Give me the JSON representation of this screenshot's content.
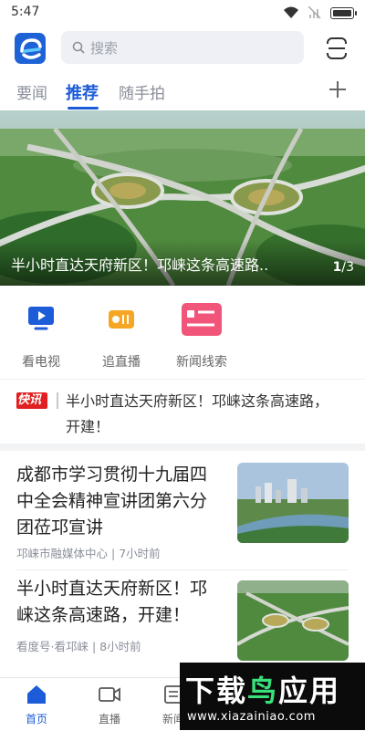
{
  "status_bar": {
    "time": "5:47"
  },
  "header": {
    "search_placeholder": "搜索"
  },
  "tabs": [
    {
      "label": "要闻",
      "active": false
    },
    {
      "label": "推荐",
      "active": true
    },
    {
      "label": "随手拍",
      "active": false
    }
  ],
  "banner": {
    "title": "半小时直达天府新区！邛崃这条高速路..",
    "index": "1",
    "total": "/3"
  },
  "quick_links": [
    {
      "label": "看电视",
      "icon": "tv-icon"
    },
    {
      "label": "追直播",
      "icon": "live-radio-icon"
    },
    {
      "label": "新闻线索",
      "icon": "news-tip-icon"
    }
  ],
  "flash": {
    "badge": "快讯",
    "text_line1": "半小时直达天府新区！邛崃这条高速路，",
    "text_line2": "开建！"
  },
  "news": [
    {
      "title": "成都市学习贯彻十九届四中全会精神宣讲团第六分团莅邛宣讲",
      "source": "邛崃市融媒体中心",
      "time": "7小时前",
      "thumb": "city-river-photo"
    },
    {
      "title": "半小时直达天府新区！邛崃这条高速路，开建！",
      "source": "看度号·看邛崃",
      "time": "8小时前",
      "thumb": "highway-interchange-photo"
    }
  ],
  "bottom_nav": [
    {
      "label": "首页",
      "icon": "home-icon",
      "active": true
    },
    {
      "label": "直播",
      "icon": "video-icon",
      "active": false
    },
    {
      "label": "新闻",
      "icon": "news-icon",
      "active": false
    }
  ],
  "watermark": {
    "title_a": "下载",
    "title_b": "鸟",
    "title_c": "应用",
    "url": "www.xiazainiao.com"
  },
  "colors": {
    "accent": "#1d5cd8",
    "flash_red": "#e02020"
  }
}
